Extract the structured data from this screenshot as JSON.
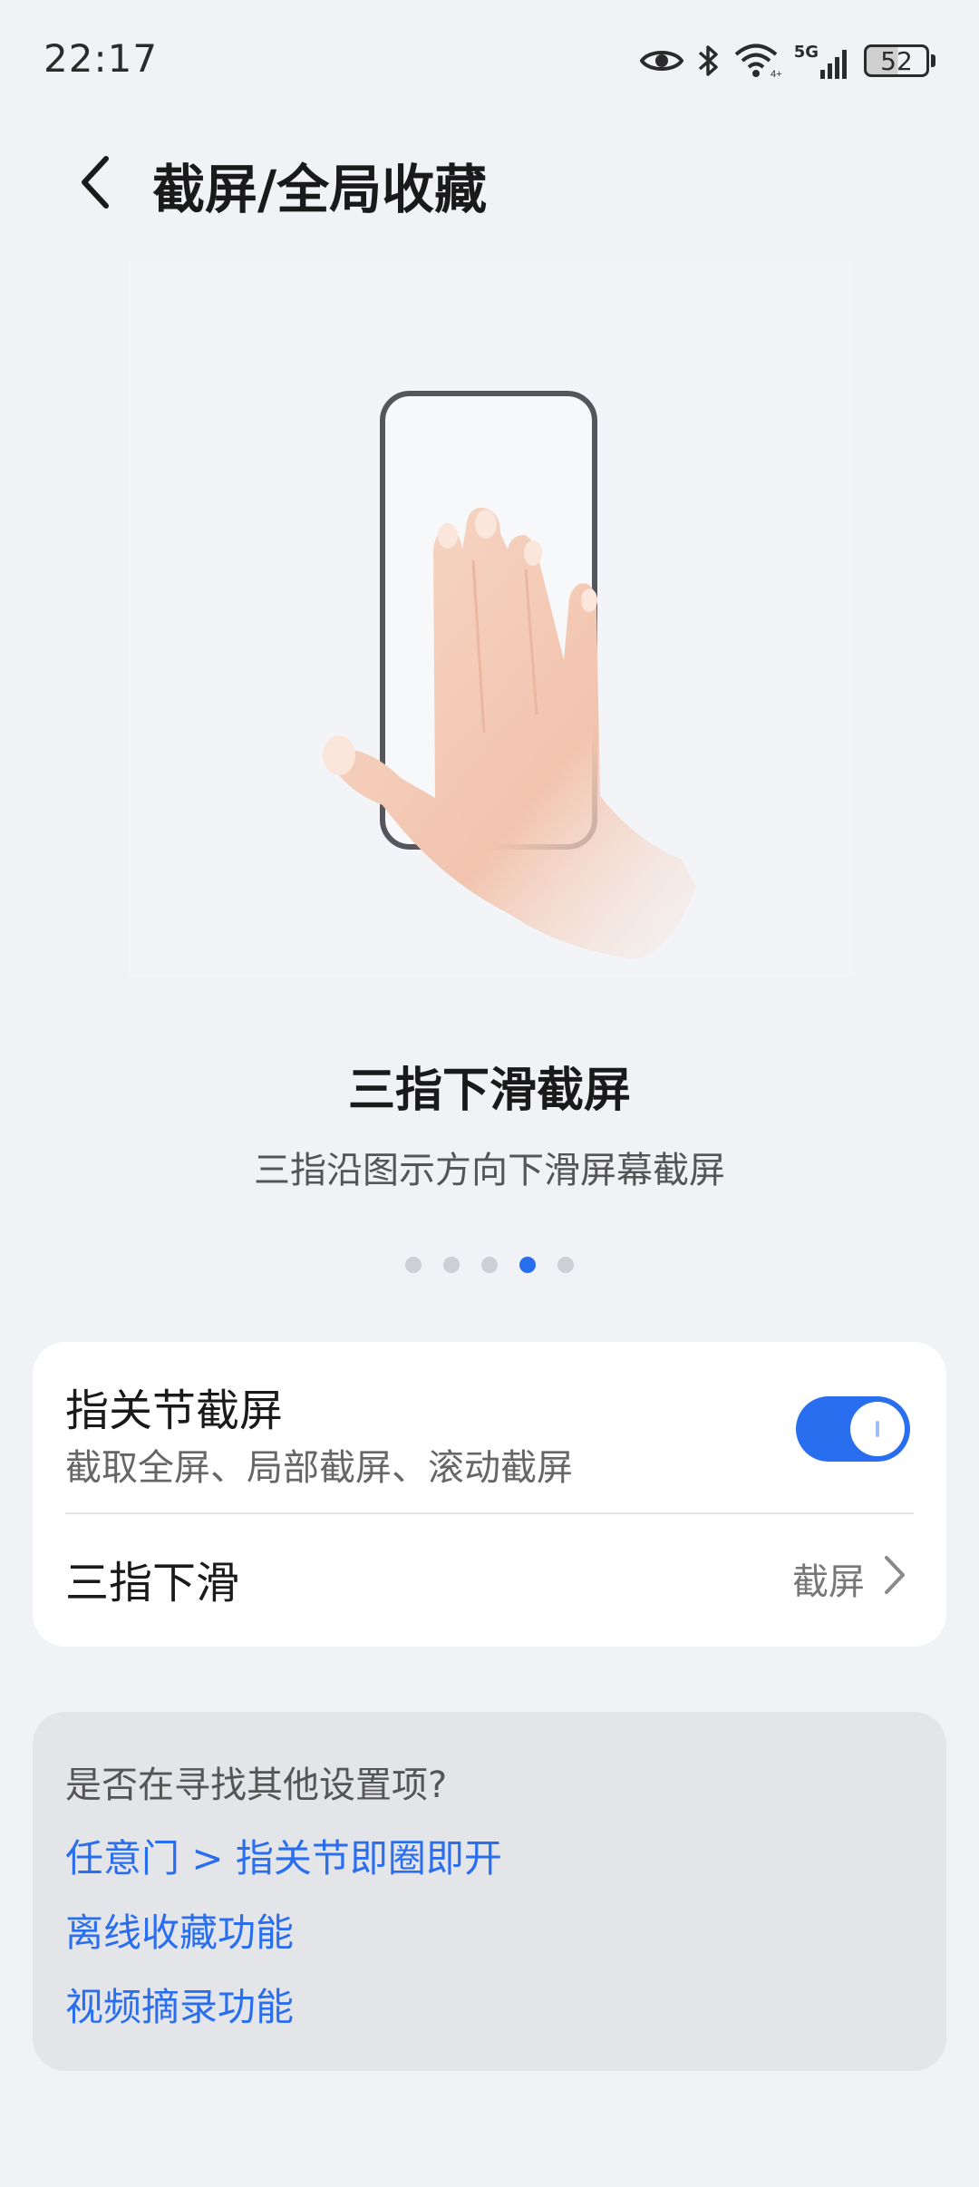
{
  "status_bar": {
    "time": "22:17",
    "network": "5G",
    "battery": "52",
    "icons": [
      "eye-icon",
      "bluetooth-icon",
      "wifi-icon",
      "signal-icon",
      "battery-icon"
    ]
  },
  "header": {
    "title": "截屏/全局收藏"
  },
  "tip": {
    "title": "三指下滑截屏",
    "subtitle": "三指沿图示方向下滑屏幕截屏"
  },
  "pager": {
    "total": 5,
    "active_index": 4
  },
  "settings": {
    "knuckle": {
      "title": "指关节截屏",
      "subtitle": "截取全屏、局部截屏、滚动截屏",
      "enabled": true
    },
    "three_finger": {
      "title": "三指下滑",
      "value": "截屏"
    }
  },
  "suggestions": {
    "question": "是否在寻找其他设置项?",
    "links": [
      "任意门 > 指关节即圈即开",
      "离线收藏功能",
      "视频摘录功能"
    ]
  },
  "colors": {
    "accent": "#2a6ef0",
    "background": "#f1f2f6"
  }
}
